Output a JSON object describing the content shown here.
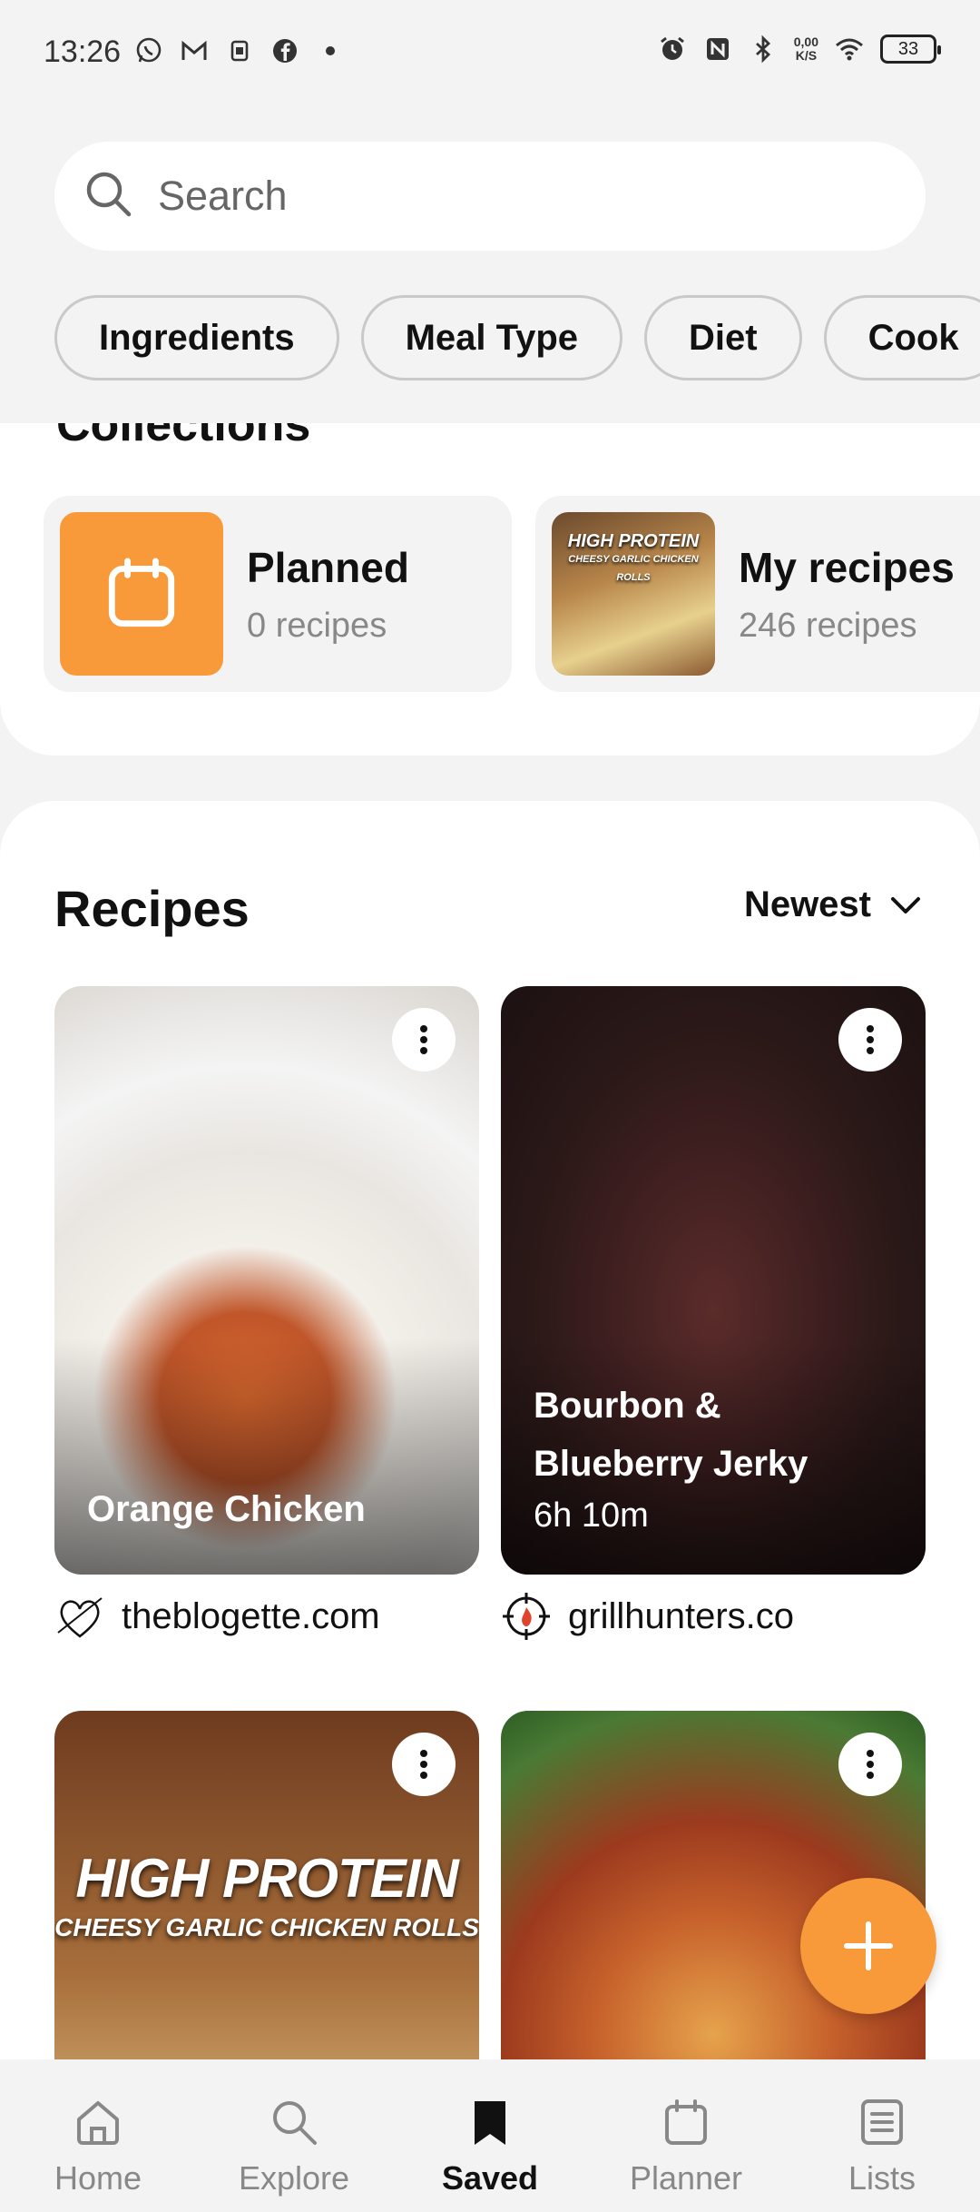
{
  "status_bar": {
    "time": "13:26",
    "net_speed_value": "0,00",
    "net_speed_unit": "K/S",
    "battery": "33"
  },
  "search": {
    "placeholder": "Search"
  },
  "filters": [
    "Ingredients",
    "Meal Type",
    "Diet",
    "Cook"
  ],
  "collections": {
    "heading": "Collections",
    "items": [
      {
        "title": "Planned",
        "count": "0 recipes",
        "icon": "calendar-icon",
        "color": "#f89a3a"
      },
      {
        "title": "My recipes",
        "count": "246 recipes",
        "thumb_title": "HIGH PROTEIN",
        "thumb_subtitle": "CHEESY GARLIC CHICKEN ROLLS"
      }
    ]
  },
  "recipes": {
    "title": "Recipes",
    "sort_label": "Newest",
    "items": [
      {
        "title": "Orange Chicken",
        "subtitle": "",
        "source": "theblogette.com"
      },
      {
        "title": "Bourbon & Blueberry Jerky",
        "subtitle": "6h 10m",
        "source": "grillhunters.co"
      },
      {
        "overlay_title": "HIGH PROTEIN",
        "overlay_subtitle": "CHEESY GARLIC CHICKEN ROLLS"
      },
      {
        "title": ""
      }
    ]
  },
  "bottom_nav": [
    {
      "label": "Home",
      "icon": "home-icon"
    },
    {
      "label": "Explore",
      "icon": "search-icon"
    },
    {
      "label": "Saved",
      "icon": "bookmark-icon",
      "active": true
    },
    {
      "label": "Planner",
      "icon": "calendar-icon"
    },
    {
      "label": "Lists",
      "icon": "list-icon"
    }
  ],
  "colors": {
    "accent": "#f89a3a",
    "background": "#f3f3f3"
  }
}
